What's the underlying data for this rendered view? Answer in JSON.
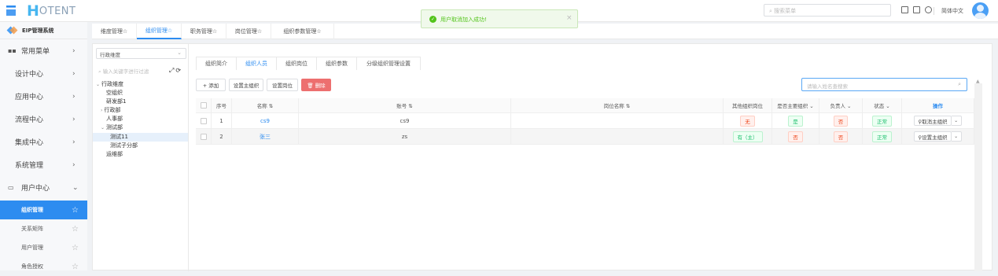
{
  "app": {
    "logo_h": "H",
    "logo_rest": "OTENT",
    "system_title": "EIP管理系统"
  },
  "header": {
    "search_placeholder": "搜索菜单",
    "lang": "简体中文"
  },
  "toast": {
    "icon": "check-circle-icon",
    "message": "用户取消加入成功!",
    "close": "×"
  },
  "sidebar": {
    "items": [
      {
        "label": "常用菜单",
        "arrow": "›",
        "icon": "grid-icon"
      },
      {
        "label": "设计中心",
        "arrow": "›"
      },
      {
        "label": "应用中心",
        "arrow": "›"
      },
      {
        "label": "流程中心",
        "arrow": "›"
      },
      {
        "label": "集成中心",
        "arrow": "›"
      },
      {
        "label": "系统管理",
        "arrow": "›"
      },
      {
        "label": "用户中心",
        "arrow": "⌄",
        "icon": "monitor-icon"
      }
    ],
    "sub_items": [
      {
        "label": "组织管理",
        "star": "☆",
        "active": true
      },
      {
        "label": "关系矩阵",
        "star": "☆"
      },
      {
        "label": "用户管理",
        "star": "☆"
      },
      {
        "label": "角色授权",
        "star": "☆"
      }
    ]
  },
  "page_tabs": [
    "维度管理☆",
    "组织管理☆",
    "职务管理☆",
    "岗位管理☆",
    "组织参数管理☆"
  ],
  "tree": {
    "select_value": "行政维度",
    "filter_placeholder": "输入关键字进行过滤",
    "tools": "⤢⟳",
    "nodes": [
      {
        "label": "行政维度",
        "caret": "⌄",
        "level": 0
      },
      {
        "label": "空组织",
        "caret": "",
        "level": 1
      },
      {
        "label": "研发部1",
        "caret": "",
        "level": 1
      },
      {
        "label": "行政部",
        "caret": "›",
        "level": 0.6
      },
      {
        "label": "人事部",
        "caret": "",
        "level": 1
      },
      {
        "label": "测试部",
        "caret": "⌄",
        "level": 0.6
      },
      {
        "label": "测试11",
        "caret": "",
        "level": 2,
        "selected": true
      },
      {
        "label": "测试子分部",
        "caret": "",
        "level": 2
      },
      {
        "label": "运维部",
        "caret": "",
        "level": 1
      }
    ]
  },
  "inner_tabs": [
    "组织简介",
    "组织人员",
    "组织岗位",
    "组织参数",
    "分级组织管理设置"
  ],
  "toolbar": {
    "add": "+ 添加",
    "set_main": "设置主组织",
    "set_post": "设置岗位",
    "delete": "🗑 删除"
  },
  "name_search": {
    "placeholder": "请输入姓名查搜索"
  },
  "table": {
    "columns": [
      "序号",
      "名称 ⇅",
      "账号 ⇅",
      "岗位名称 ⇅",
      "其他组织岗位",
      "是否主要组织 ⌄",
      "负责人 ⌄",
      "状态 ⌄",
      "操作"
    ],
    "rows": [
      {
        "index": "1",
        "name": "cs9",
        "account": "cs9",
        "post": "",
        "other_post": "无",
        "is_main": "是",
        "leader": "否",
        "status": "正常",
        "op": "⚲取消主组织",
        "dd": "⌄"
      },
      {
        "index": "2",
        "name": "张三",
        "account": "zs",
        "post": "",
        "other_post": "有（主）",
        "is_main": "否",
        "leader": "否",
        "status": "正常",
        "op": "⚲设置主组织",
        "dd": "⌄"
      }
    ]
  },
  "colors": {
    "accent": "#2d8cf0",
    "danger": "#ed6f6f",
    "success": "#19be6b"
  }
}
